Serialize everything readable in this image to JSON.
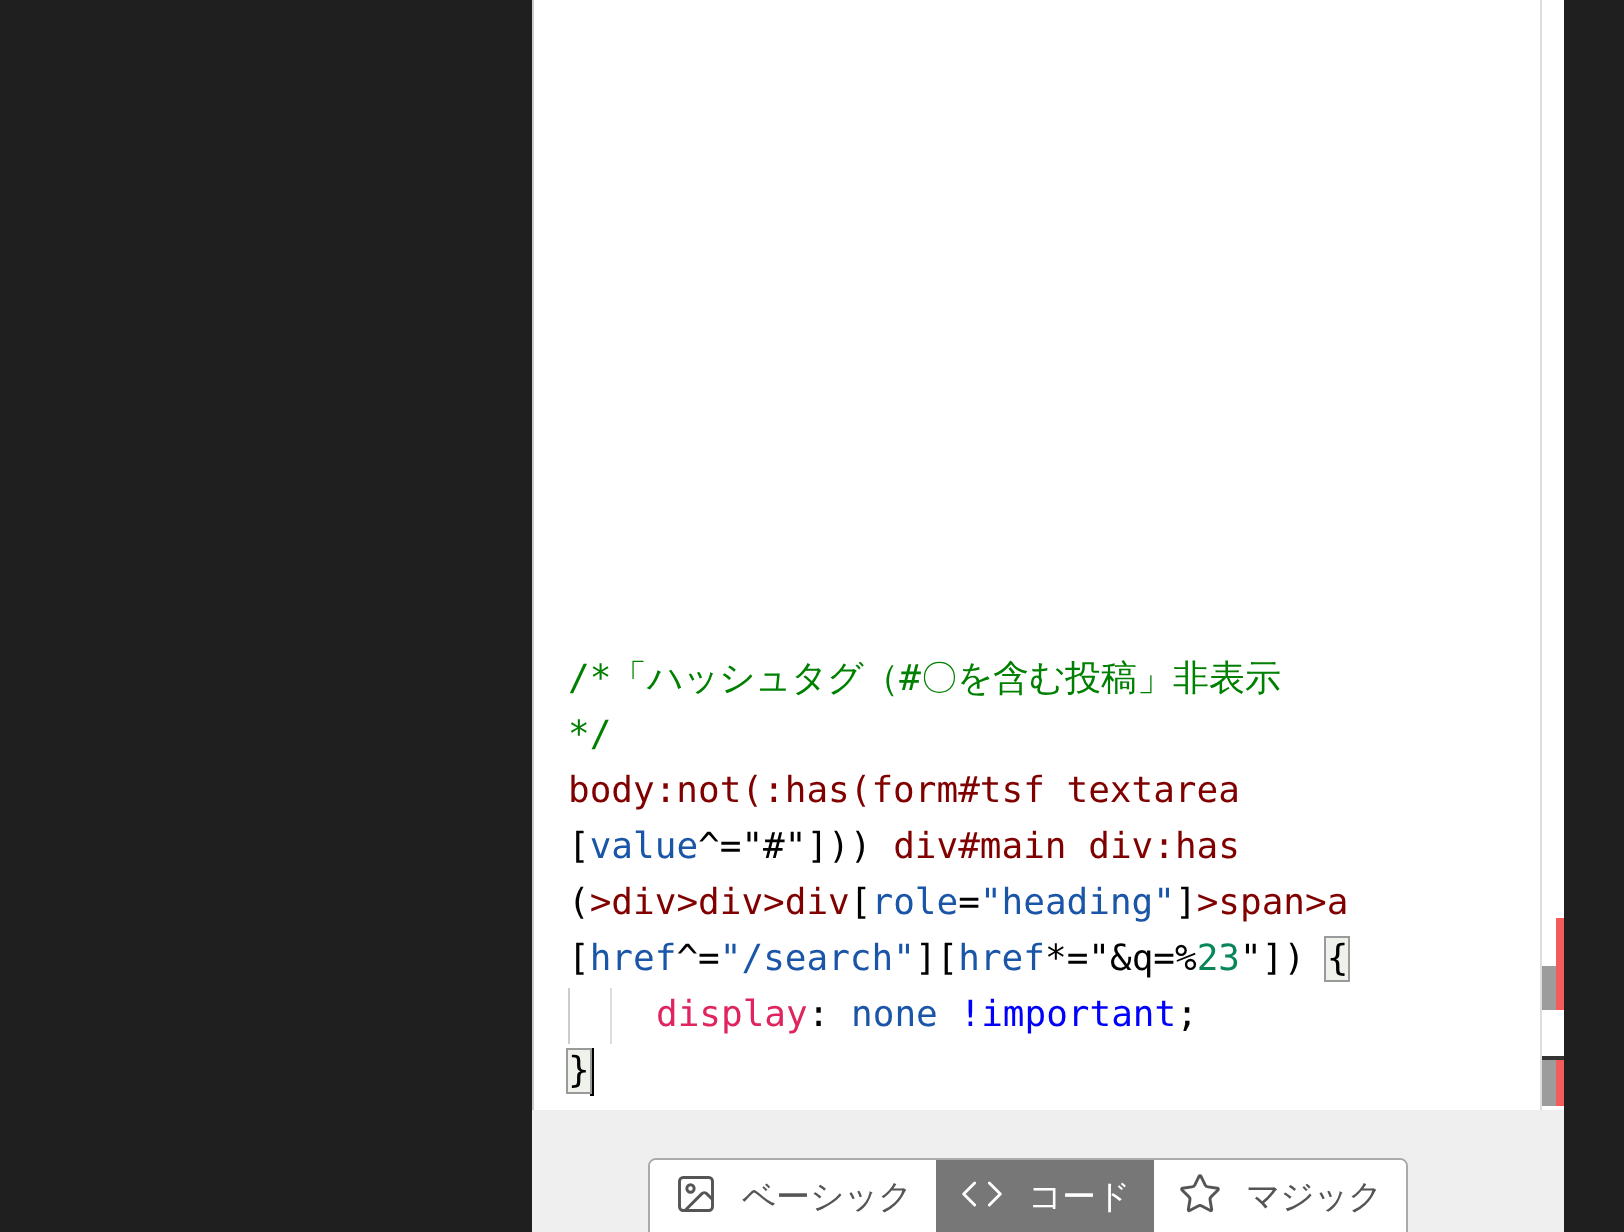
{
  "code_lines": [
    [
      {
        "kind": "comment",
        "text": "/*「ハッシュタグ（#〇を含む投稿」非表示"
      }
    ],
    [
      {
        "kind": "comment",
        "text": "*/"
      }
    ],
    [
      {
        "kind": "selector",
        "text": "body:not(:has(form#tsf textarea"
      }
    ],
    [
      {
        "kind": "punct",
        "text": "["
      },
      {
        "kind": "attr",
        "text": "value"
      },
      {
        "kind": "punct",
        "text": "^=\"#\"])) "
      },
      {
        "kind": "selector",
        "text": "div#main div:has"
      }
    ],
    [
      {
        "kind": "punct",
        "text": "("
      },
      {
        "kind": "selector",
        "text": ">div>div>div"
      },
      {
        "kind": "punct",
        "text": "["
      },
      {
        "kind": "attr",
        "text": "role"
      },
      {
        "kind": "punct",
        "text": "="
      },
      {
        "kind": "attr",
        "text": "\"heading\""
      },
      {
        "kind": "punct",
        "text": "]"
      },
      {
        "kind": "selector",
        "text": ">span>a"
      }
    ],
    [
      {
        "kind": "punct",
        "text": "["
      },
      {
        "kind": "attr",
        "text": "href"
      },
      {
        "kind": "punct",
        "text": "^="
      },
      {
        "kind": "attr",
        "text": "\"/search\""
      },
      {
        "kind": "punct",
        "text": "]["
      },
      {
        "kind": "attr",
        "text": "href"
      },
      {
        "kind": "punct",
        "text": "*=\"&q=%"
      },
      {
        "kind": "number",
        "text": "23"
      },
      {
        "kind": "punct",
        "text": "\"]) "
      },
      {
        "kind": "bracket",
        "text": "{"
      }
    ],
    [
      {
        "kind": "indent"
      },
      {
        "kind": "property",
        "text": "display"
      },
      {
        "kind": "punct",
        "text": ": "
      },
      {
        "kind": "value",
        "text": "none "
      },
      {
        "kind": "important",
        "text": "!important"
      },
      {
        "kind": "punct",
        "text": ";"
      }
    ],
    [
      {
        "kind": "bracket",
        "text": "}"
      },
      {
        "kind": "cursor"
      }
    ]
  ],
  "mode_tabs": [
    {
      "kind": "basic",
      "label": "ベーシック",
      "selected": false
    },
    {
      "kind": "code",
      "label": "コード",
      "selected": true
    },
    {
      "kind": "magic",
      "label": "マジック",
      "selected": false
    }
  ]
}
